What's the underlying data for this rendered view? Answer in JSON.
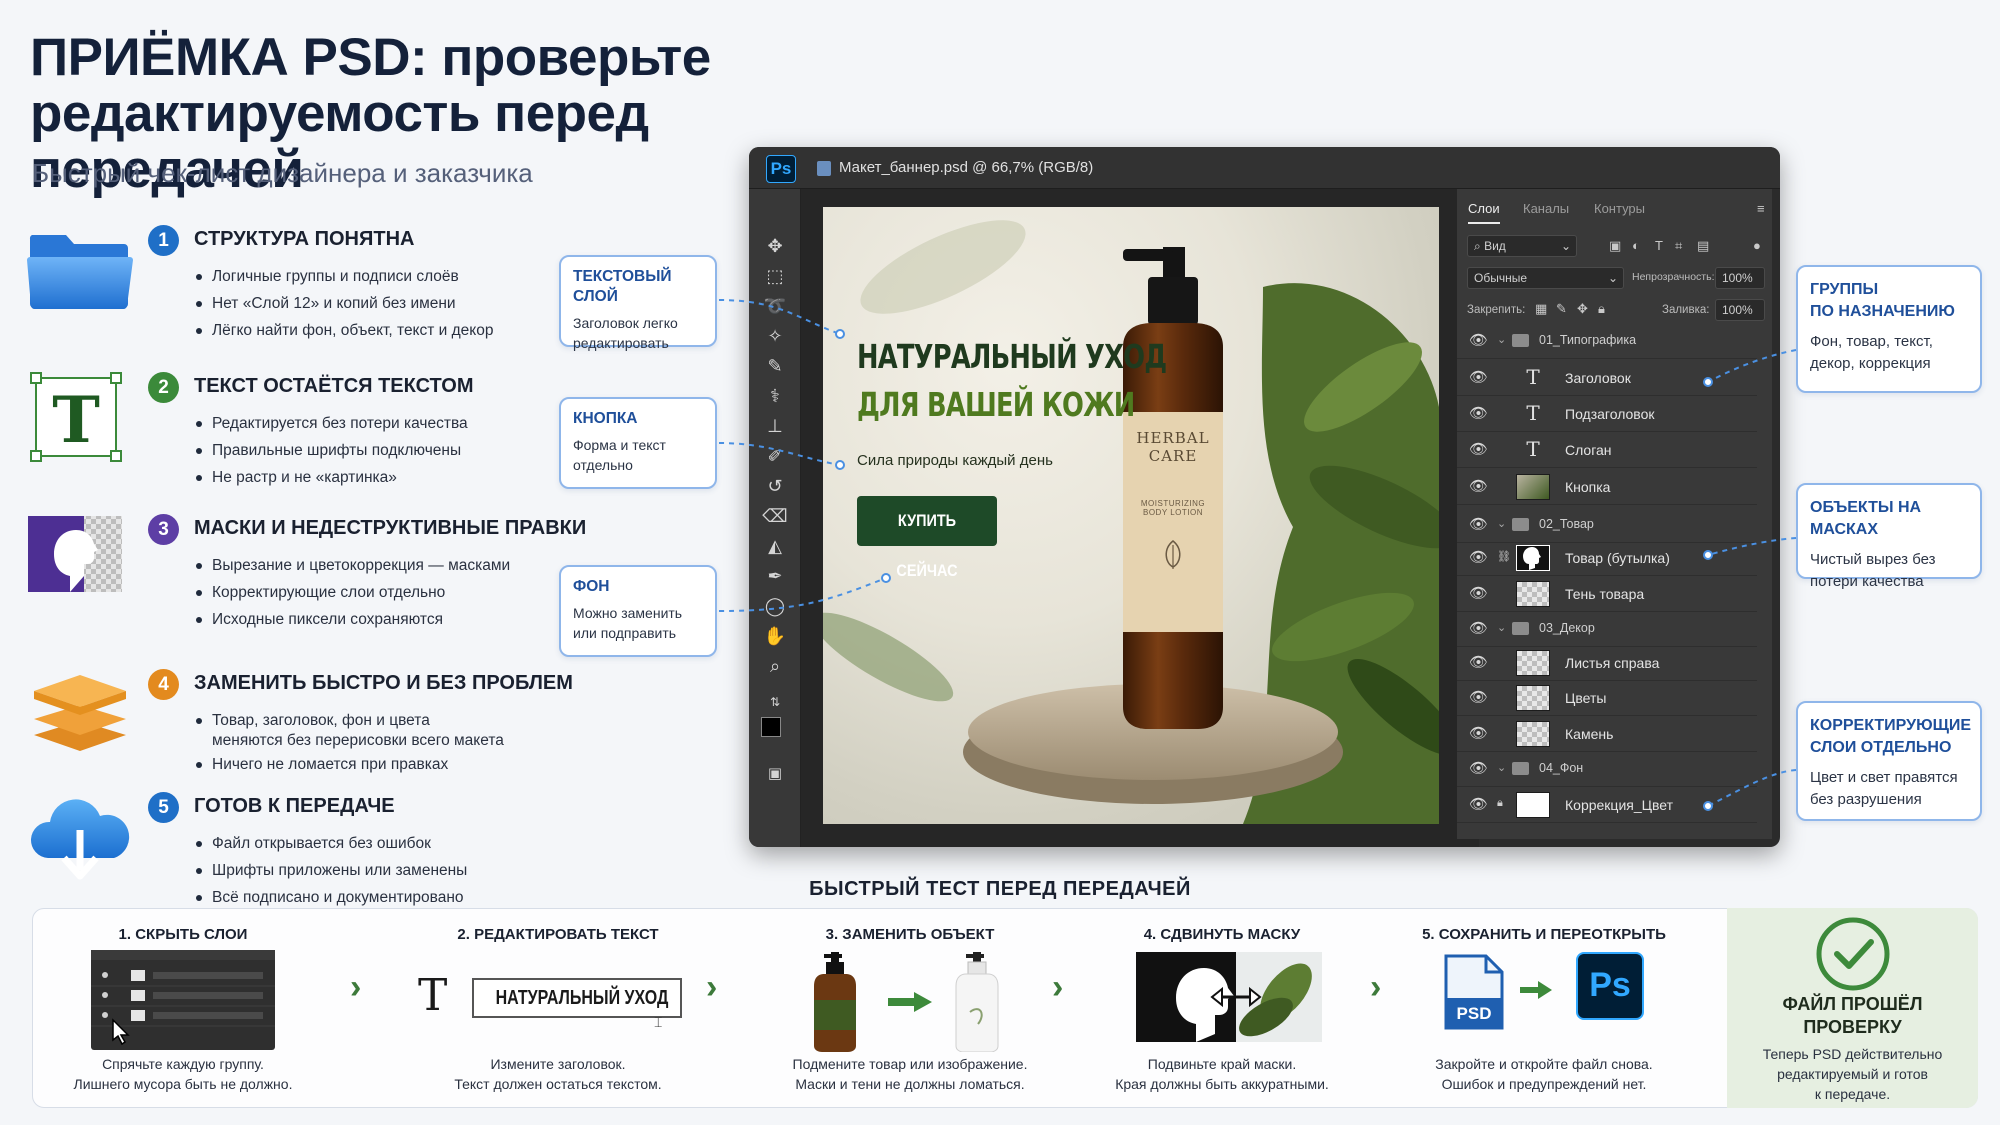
{
  "header": {
    "title_line1": "ПРИЁМКА PSD: проверьте",
    "title_line2": "редактируемость перед передачей",
    "subtitle": "Быстрый чек-лист дизайнера и заказчика"
  },
  "checklist": [
    {
      "num": "1",
      "title": "СТРУКТУРА ПОНЯТНА",
      "color": "#1f6fc7",
      "items": [
        "Логичные группы и подписи слоёв",
        "Нет «Слой 12» и копий без имени",
        "Лёгко найти фон, объект, текст и декор"
      ]
    },
    {
      "num": "2",
      "title": "ТЕКСТ ОСТАЁТСЯ ТЕКСТОМ",
      "color": "#3b8a3a",
      "items": [
        "Редактируется без потери качества",
        "Правильные шрифты подключены",
        "Не растр и не «картинка»"
      ]
    },
    {
      "num": "3",
      "title": "МАСКИ И НЕДЕСТРУКТИВНЫЕ ПРАВКИ",
      "color": "#5d3ea5",
      "items": [
        "Вырезание и цветокоррекция — масками",
        "Корректирующие слои отдельно",
        "Исходные пиксели сохраняются"
      ]
    },
    {
      "num": "4",
      "title": "ЗАМЕНИТЬ БЫСТРО И БЕЗ ПРОБЛЕМ",
      "color": "#e38a1e",
      "items": [
        "Товар, заголовок, фон и цвета",
        "меняются без перерисовки всего макета",
        "Ничего не ломается при правках"
      ]
    },
    {
      "num": "5",
      "title": "ГОТОВ К ПЕРЕДАЧЕ",
      "color": "#1f6fc7",
      "items": [
        "Файл открывается без ошибок",
        "Шрифты приложены или заменены",
        "Всё подписано и документировано"
      ]
    }
  ],
  "callouts_left": [
    {
      "title": "ТЕКСТОВЫЙ СЛОЙ",
      "body": "Заголовок легко редактировать"
    },
    {
      "title": "КНОПКА",
      "body": "Форма и текст отдельно"
    },
    {
      "title": "ФОН",
      "body": "Можно заменить или подправить"
    }
  ],
  "photoshop": {
    "logo": "Ps",
    "doc_title": "Макет_баннер.psd @ 66,7% (RGB/8)",
    "banner": {
      "headline1": "НАТУРАЛЬНЫЙ УХОД",
      "headline2": "ДЛЯ ВАШЕЙ КОЖИ",
      "slogan": "Сила природы каждый день",
      "button": "КУПИТЬ СЕЙЧАС",
      "label_brand1": "HERBAL",
      "label_brand2": "CARE",
      "label_sub1": "MOISTURIZING",
      "label_sub2": "BODY LOTION"
    },
    "panel": {
      "tabs": [
        "Слои",
        "Каналы",
        "Контуры"
      ],
      "filter": "Вид",
      "blend_mode": "Обычные",
      "opacity_label": "Непрозрачность:",
      "opacity": "100%",
      "lock_label": "Закрепить:",
      "fill_label": "Заливка:",
      "fill": "100%",
      "layers": [
        {
          "name": "01_Типографика",
          "kind": "group"
        },
        {
          "name": "Заголовок",
          "kind": "text"
        },
        {
          "name": "Подзаголовок",
          "kind": "text"
        },
        {
          "name": "Слоган",
          "kind": "text"
        },
        {
          "name": "Кнопка",
          "kind": "image"
        },
        {
          "name": "02_Товар",
          "kind": "group"
        },
        {
          "name": "Товар (бутылка)",
          "kind": "masked"
        },
        {
          "name": "Тень товара",
          "kind": "image"
        },
        {
          "name": "03_Декор",
          "kind": "group"
        },
        {
          "name": "Листья справа",
          "kind": "image"
        },
        {
          "name": "Цветы",
          "kind": "image"
        },
        {
          "name": "Камень",
          "kind": "image"
        },
        {
          "name": "04_Фон",
          "kind": "group"
        },
        {
          "name": "Коррекция_Цвет",
          "kind": "adjust"
        }
      ]
    }
  },
  "callouts_right": [
    {
      "title_line1": "ГРУППЫ",
      "title_line2": "ПО НАЗНАЧЕНИЮ",
      "body": "Фон, товар, текст, декор, коррекция"
    },
    {
      "title_line1": "ОБЪЕКТЫ НА МАСКАХ",
      "title_line2": "",
      "body": "Чистый вырез без потери качества"
    },
    {
      "title_line1": "КОРРЕКТИРУЮЩИЕ",
      "title_line2": "СЛОИ ОТДЕЛЬНО",
      "body": "Цвет и свет правятся без разрушения"
    }
  ],
  "quick_test": {
    "heading": "БЫСТРЫЙ ТЕСТ ПЕРЕД ПЕРЕДАЧЕЙ",
    "steps": [
      {
        "title": "1. СКРЫТЬ СЛОИ",
        "cap1": "Спрячьте каждую группу.",
        "cap2": "Лишнего мусора быть не должно."
      },
      {
        "title": "2. РЕДАКТИРОВАТЬ ТЕКСТ",
        "cap1": "Измените заголовок.",
        "cap2": "Текст должен остаться текстом.",
        "sample": "НАТУРАЛЬНЫЙ УХОД"
      },
      {
        "title": "3. ЗАМЕНИТЬ ОБЪЕКТ",
        "cap1": "Подмените товар или изображение.",
        "cap2": "Маски и тени не должны ломаться."
      },
      {
        "title": "4. СДВИНУТЬ МАСКУ",
        "cap1": "Подвиньте край маски.",
        "cap2": "Края должны быть аккуратными."
      },
      {
        "title": "5. СОХРАНИТЬ И ПЕРЕОТКРЫТЬ",
        "cap1": "Закройте и откройте файл снова.",
        "cap2": "Ошибок и предупреждений нет.",
        "psd_label": "PSD",
        "ps_label": "Ps"
      }
    ],
    "done": {
      "title1": "ФАЙЛ ПРОШЁЛ",
      "title2": "ПРОВЕРКУ",
      "body1": "Теперь PSD действительно",
      "body2": "редактируемый и готов",
      "body3": "к передаче."
    }
  }
}
